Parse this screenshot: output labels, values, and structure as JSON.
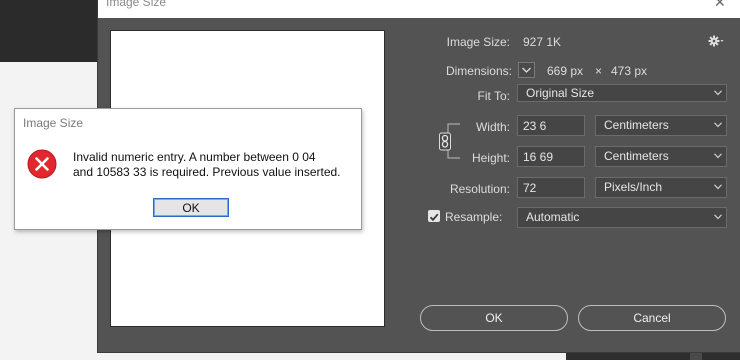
{
  "image_size_dialog": {
    "title": "Image Size",
    "close_glyph": "✕",
    "image_size_label": "Image Size:",
    "image_size_value": "927 1K",
    "dimensions_label": "Dimensions:",
    "dimensions_width": "669 px",
    "dimensions_times": "×",
    "dimensions_height": "473 px",
    "fit_to_label": "Fit To:",
    "fit_to_value": "Original Size",
    "width_label": "Width:",
    "width_value": "23 6",
    "width_unit": "Centimeters",
    "height_label": "Height:",
    "height_value": "16 69",
    "height_unit": "Centimeters",
    "resolution_label": "Resolution:",
    "resolution_value": "72",
    "resolution_unit": "Pixels/Inch",
    "resample_label": "Resample:",
    "resample_checked": true,
    "resample_value": "Automatic",
    "ok_label": "OK",
    "cancel_label": "Cancel"
  },
  "alert_dialog": {
    "title": "Image Size",
    "message": "Invalid numeric entry. A number between 0 04\nand 10583 33 is required.  Previous value inserted.",
    "icon": "error-icon",
    "ok_label": "OK"
  },
  "colors": {
    "dialog_bg": "#535353",
    "error_red": "#e0282e",
    "focus_blue": "#2a6bc9"
  }
}
